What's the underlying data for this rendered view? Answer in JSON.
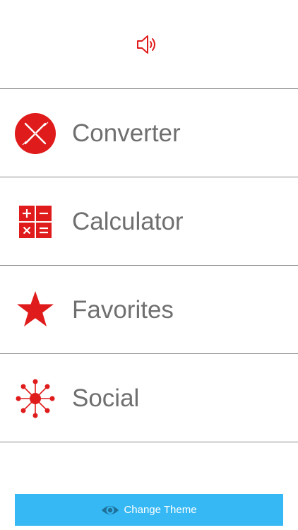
{
  "header": {
    "sound_icon": "speaker-icon"
  },
  "menu": {
    "items": [
      {
        "label": "Converter",
        "icon": "converter-x-circle-icon"
      },
      {
        "label": "Calculator",
        "icon": "calculator-icon"
      },
      {
        "label": "Favorites",
        "icon": "star-icon"
      },
      {
        "label": "Social",
        "icon": "network-icon"
      }
    ]
  },
  "footer": {
    "theme_button_label": "Change Theme",
    "theme_button_icon": "eye-icon"
  },
  "colors": {
    "accent_red": "#e01b1b",
    "label_gray": "#6f6f6f",
    "button_blue": "#35b8f4",
    "eye_dark": "#1f6f97",
    "divider": "#8a8a8a"
  }
}
